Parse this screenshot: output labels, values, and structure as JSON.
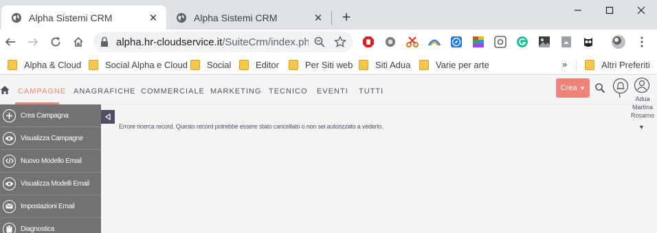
{
  "browser": {
    "tabs": [
      {
        "title": "Alpha Sistemi CRM",
        "active": true
      },
      {
        "title": "Alpha Sistemi CRM",
        "active": false
      }
    ],
    "close_glyph": "✕",
    "new_tab_glyph": "+",
    "url_host": "alpha.hr-cloudservice.it",
    "url_path": "/SuiteCrm/index.ph...",
    "extensions": [
      "adblock-icon",
      "extension-circle-icon",
      "scissors-icon",
      "rainbow-icon",
      "compass-icon",
      "palette-icon",
      "screenshot-icon",
      "grammarly-icon",
      "photo-icon",
      "pdf-icon",
      "owl-icon"
    ]
  },
  "bookmarks": {
    "items": [
      "Alpha & Cloud",
      "Social Alpha e Cloud",
      "Social",
      "Editor",
      "Per Siti web",
      "Siti Adua",
      "Varie per arte"
    ],
    "more": "»",
    "other": "Altri Preferiti"
  },
  "crm": {
    "nav": [
      "CAMPAGNE",
      "ANAGRAFICHE",
      "COMMERCIALE",
      "MARKETING",
      "TECNICO",
      "EVENTI",
      "TUTTI"
    ],
    "active_nav": "CAMPAGNE",
    "create_label": "Crea",
    "user_name_lines": [
      "Adua",
      "Martina",
      "Rosarno"
    ],
    "sidebar": [
      {
        "label": "Crea Campagna",
        "icon": "plus-icon"
      },
      {
        "label": "Visualizza Campagne",
        "icon": "eye-icon"
      },
      {
        "label": "Nuovo Modello Email",
        "icon": "code-icon"
      },
      {
        "label": "Visualizza Modelli Email",
        "icon": "eye-icon"
      },
      {
        "label": "Impostazioni Email",
        "icon": "email-icon"
      },
      {
        "label": "Diagnostica",
        "icon": "diagnostics-icon"
      }
    ],
    "error_message": "Errore ricerca record. Questo record potrebbe essere stato cancellato o non sei autorizzato a vederlo.",
    "colors": {
      "accent": "#f08377",
      "sidebar": "#727272",
      "text": "#534d64"
    }
  }
}
